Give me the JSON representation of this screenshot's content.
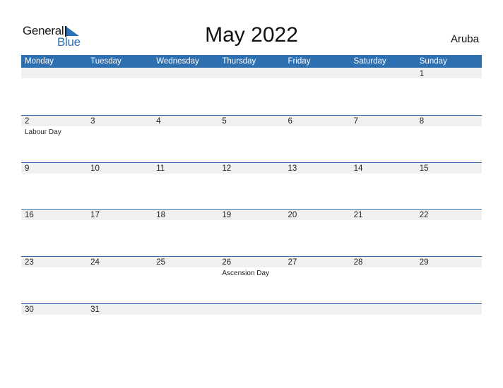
{
  "brand": {
    "word1": "General",
    "word2": "Blue",
    "accent_color": "#2a72b5"
  },
  "title": "May 2022",
  "country": "Aruba",
  "colors": {
    "header_bg": "#2e6fb0",
    "row_strip": "#f0f0f0",
    "rule": "#2e6fb0"
  },
  "weekdays": [
    "Monday",
    "Tuesday",
    "Wednesday",
    "Thursday",
    "Friday",
    "Saturday",
    "Sunday"
  ],
  "weeks": [
    {
      "days": [
        {
          "num": ""
        },
        {
          "num": ""
        },
        {
          "num": ""
        },
        {
          "num": ""
        },
        {
          "num": ""
        },
        {
          "num": ""
        },
        {
          "num": "1"
        }
      ]
    },
    {
      "days": [
        {
          "num": "2",
          "holiday": "Labour Day"
        },
        {
          "num": "3"
        },
        {
          "num": "4"
        },
        {
          "num": "5"
        },
        {
          "num": "6"
        },
        {
          "num": "7"
        },
        {
          "num": "8"
        }
      ]
    },
    {
      "days": [
        {
          "num": "9"
        },
        {
          "num": "10"
        },
        {
          "num": "11"
        },
        {
          "num": "12"
        },
        {
          "num": "13"
        },
        {
          "num": "14"
        },
        {
          "num": "15"
        }
      ]
    },
    {
      "days": [
        {
          "num": "16"
        },
        {
          "num": "17"
        },
        {
          "num": "18"
        },
        {
          "num": "19"
        },
        {
          "num": "20"
        },
        {
          "num": "21"
        },
        {
          "num": "22"
        }
      ]
    },
    {
      "days": [
        {
          "num": "23"
        },
        {
          "num": "24"
        },
        {
          "num": "25"
        },
        {
          "num": "26",
          "holiday": "Ascension Day"
        },
        {
          "num": "27"
        },
        {
          "num": "28"
        },
        {
          "num": "29"
        }
      ]
    },
    {
      "days": [
        {
          "num": "30"
        },
        {
          "num": "31"
        },
        {
          "num": ""
        },
        {
          "num": ""
        },
        {
          "num": ""
        },
        {
          "num": ""
        },
        {
          "num": ""
        }
      ]
    }
  ]
}
